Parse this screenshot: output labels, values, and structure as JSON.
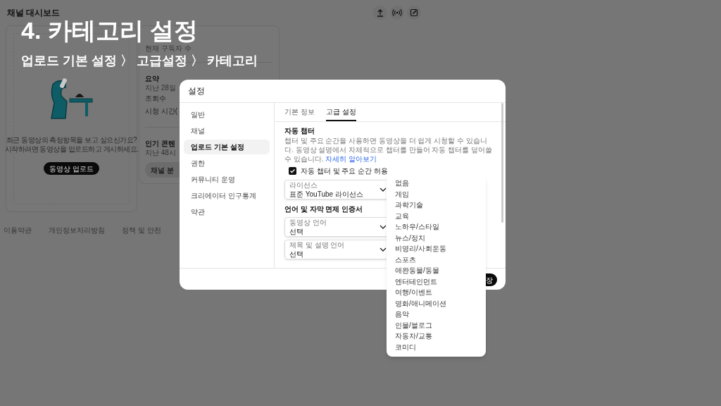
{
  "page": {
    "title": "채널 대시보드"
  },
  "caption": {
    "title": "4. 카테고리 설정",
    "subtitle": "업로드 기본 설정 〉 고급설정 〉 카테고리"
  },
  "empty_card": {
    "lines": [
      "최근 동영상의 측정항목을 보고 싶으신가요?",
      "시작하려면 동영상을 업로드하고 게시하세요."
    ],
    "button": "동영상 업로드"
  },
  "analytics_card": {
    "items": [
      {
        "kind": "label",
        "text": "현재 구독자 수"
      },
      {
        "kind": "divider"
      },
      {
        "kind": "heading",
        "text": "요약"
      },
      {
        "kind": "label",
        "text": "지난 28일"
      },
      {
        "kind": "row",
        "text": "조회수"
      },
      {
        "kind": "row",
        "text": "시청 시간("
      },
      {
        "kind": "divider"
      },
      {
        "kind": "heading",
        "text": "인기 콘텐"
      },
      {
        "kind": "label",
        "text": "지난 48시"
      },
      {
        "kind": "button",
        "text": "채널 분"
      }
    ]
  },
  "footer_links": [
    "이용약관",
    "개인정보처리방침",
    "정책 및 안전"
  ],
  "dialog": {
    "title": "설정",
    "nav": [
      {
        "label": "일반",
        "selected": false
      },
      {
        "label": "채널",
        "selected": false
      },
      {
        "label": "업로드 기본 설정",
        "selected": true
      },
      {
        "label": "권한",
        "selected": false
      },
      {
        "label": "커뮤니티 운영",
        "selected": false
      },
      {
        "label": "크리에이터 인구통계",
        "selected": false
      },
      {
        "label": "약관",
        "selected": false
      }
    ],
    "tabs": [
      {
        "label": "기본 정보",
        "selected": false
      },
      {
        "label": "고급 설정",
        "selected": true
      }
    ],
    "section": {
      "title": "자동 챕터",
      "description": "챕터 및 주요 순간을 사용하면 동영상을 더 쉽게 시청할 수 있습니다. 동영상 설명에서 자체적으로 챕터를 만들어 자동 챕터를 덮어쓸 수 있습니다.",
      "link": "자세히 알아보기",
      "checkbox": {
        "label": "자동 챕터 및 주요 순간 허용",
        "checked": true
      }
    },
    "fields": [
      {
        "kind": "select",
        "label": "라이선스",
        "value": "표준 YouTube 라이선스"
      },
      {
        "kind": "heading",
        "text": "언어 및 자막 면제 인증서"
      },
      {
        "kind": "select",
        "label": "동영상 언어",
        "value": "선택"
      },
      {
        "kind": "select",
        "label": "제목 및 설명 언어",
        "value": "선택"
      }
    ],
    "save_button": "장"
  },
  "category_menu": {
    "options": [
      "없음",
      "게임",
      "과학기술",
      "교육",
      "노하우/스타일",
      "뉴스/정치",
      "비영리/사회운동",
      "스포츠",
      "애완동물/동물",
      "엔터테인먼트",
      "여행/이벤트",
      "영화/애니메이션",
      "음악",
      "인물/블로그",
      "자동차/교통",
      "코미디"
    ]
  }
}
